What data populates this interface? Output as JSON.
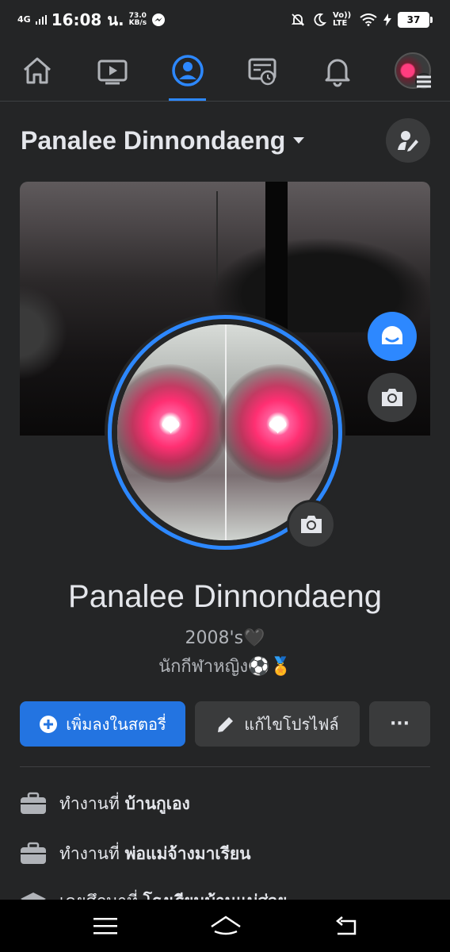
{
  "status": {
    "network": "4G",
    "time": "16:08 น.",
    "speed_value": "73.0",
    "speed_unit": "KB/s",
    "volte": "Vo)) LTE",
    "battery": "37"
  },
  "nav": {
    "items": [
      "home-icon",
      "video-icon",
      "profile-icon",
      "news-feed-icon",
      "bell-icon",
      "menu-avatar"
    ],
    "active": "profile-icon",
    "accent": "#2d88ff"
  },
  "header": {
    "name": "Panalee Dinnondaeng"
  },
  "profile": {
    "name": "Panalee Dinnondaeng",
    "bio_line1": "2008's🖤",
    "bio_line2": "นักกีฬาหญิง⚽🏅"
  },
  "actions": {
    "add_story": "เพิ่มลงในสตอรี่",
    "edit_profile": "แก้ไขโปรไฟล์",
    "more": "···"
  },
  "info": [
    {
      "prefix": "ทำงานที่",
      "value": "บ้านกูเอง"
    },
    {
      "prefix": "ทำงานที่",
      "value": "พ่อแม่จ้างมาเรียน"
    },
    {
      "prefix": "เคยศึกษาที่",
      "value": "โรงเรียนบ้านแม่ส่วย"
    }
  ],
  "colors": {
    "background": "#242526",
    "primary_button": "#2374e1",
    "secondary_button": "#3a3b3c"
  }
}
